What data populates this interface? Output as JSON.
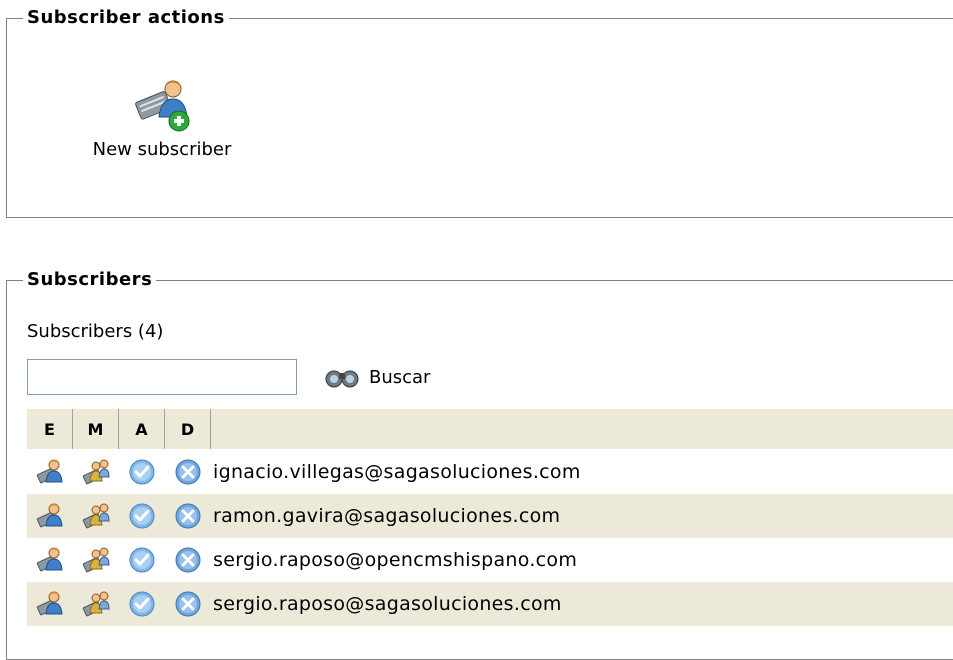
{
  "actions_section": {
    "title": "Subscriber actions",
    "new_subscriber_label": "New subscriber"
  },
  "subscribers_section": {
    "title": "Subscribers",
    "count_text": "Subscribers (4)",
    "search": {
      "value": "",
      "placeholder": "",
      "button_label": "Buscar"
    },
    "columns": [
      "E",
      "M",
      "A",
      "D"
    ],
    "rows": [
      {
        "email": "ignacio.villegas@sagasoluciones.com"
      },
      {
        "email": "ramon.gavira@sagasoluciones.com"
      },
      {
        "email": "sergio.raposo@opencmshispano.com"
      },
      {
        "email": "sergio.raposo@sagasoluciones.com"
      }
    ]
  },
  "icons": {
    "new_subscriber": "new-subscriber-icon",
    "search": "binoculars-icon",
    "edit": "edit-user-icon",
    "move": "move-user-icon",
    "activate": "check-icon",
    "delete": "delete-icon"
  },
  "colors": {
    "row_alt": "#ece9d8",
    "header_bg": "#ece9d8",
    "input_border": "#7f9db9"
  }
}
